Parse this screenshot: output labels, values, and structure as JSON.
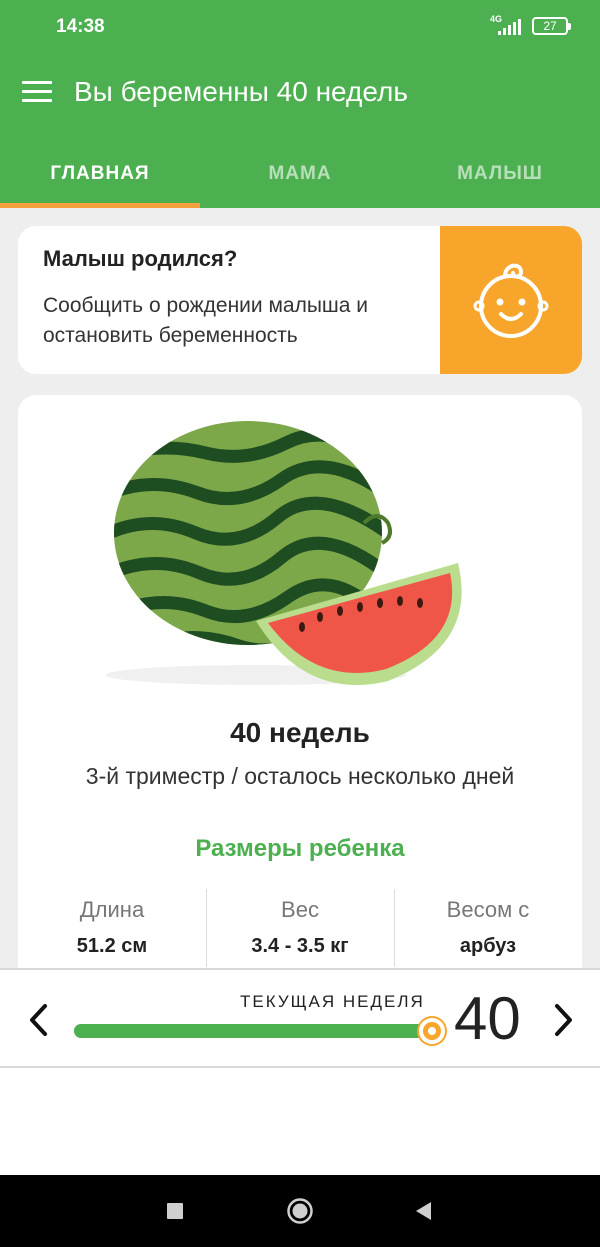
{
  "status_bar": {
    "time": "14:38",
    "network": "4G",
    "battery": "27"
  },
  "app_bar": {
    "title": "Вы беременны 40 недель",
    "menu_icon": "hamburger-menu-icon"
  },
  "tabs": [
    {
      "label": "ГЛАВНАЯ",
      "active": true
    },
    {
      "label": "МАМА",
      "active": false
    },
    {
      "label": "МАЛЫШ",
      "active": false
    }
  ],
  "born_card": {
    "title": "Малыш родился?",
    "text": "Сообщить о рождении малыша и остановить беременность",
    "icon": "baby-face-icon"
  },
  "info_card": {
    "image": "watermelon-illustration",
    "weeks_title": "40 недель",
    "trimester": "3-й триместр / осталось несколько дней",
    "sizes_title": "Размеры ребенка",
    "stats": [
      {
        "label": "Длина",
        "value": "51.2 см"
      },
      {
        "label": "Вес",
        "value": "3.4 - 3.5 кг"
      },
      {
        "label": "Весом с",
        "value": "арбуз"
      }
    ]
  },
  "week_selector": {
    "label": "ТЕКУЩАЯ НЕДЕЛЯ",
    "current_week": "40",
    "progress_fraction": 1.0,
    "prev_icon": "chevron-left-icon",
    "next_icon": "chevron-right-icon"
  },
  "nav_bar": {
    "buttons": [
      "recents-square-icon",
      "home-circle-icon",
      "back-triangle-icon"
    ]
  },
  "colors": {
    "primary": "#4caf50",
    "accent": "#f7a52b",
    "tab_indicator": "#f5a03a",
    "background": "#eeeeee"
  }
}
